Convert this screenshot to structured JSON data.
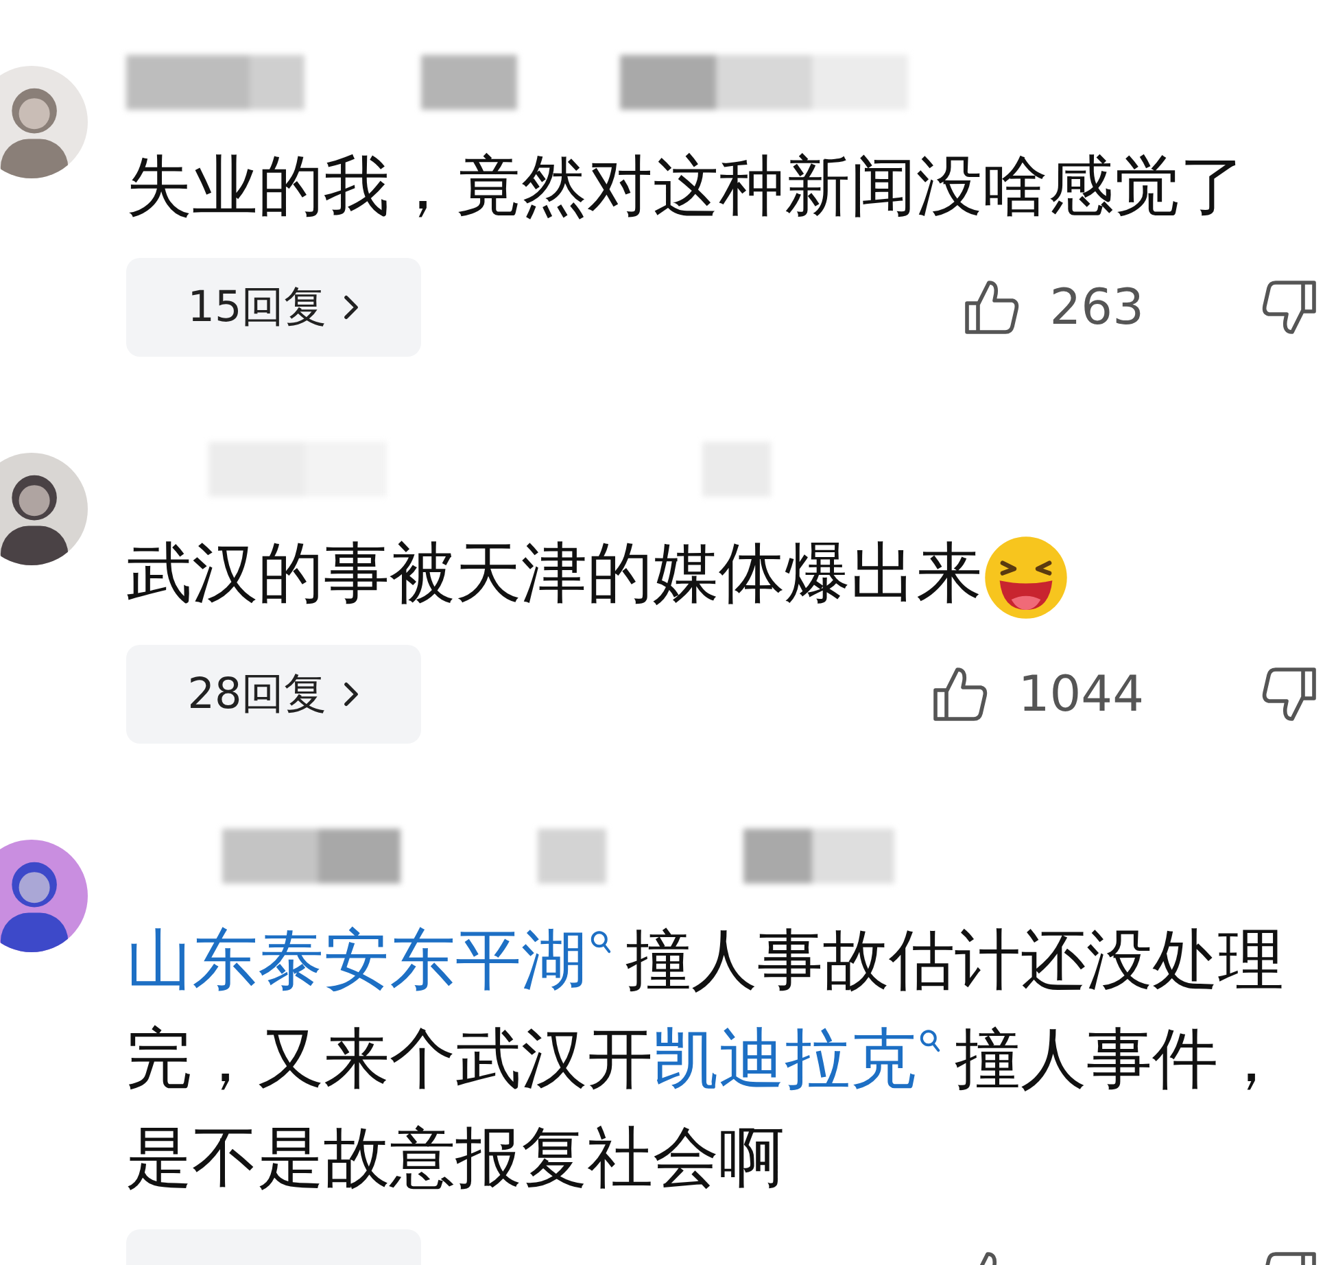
{
  "comments": [
    {
      "avatar": {
        "kind": "picture"
      },
      "text": [
        {
          "kind": "text",
          "text": "失业的我，竟然对这种新闻没啥感觉了"
        }
      ],
      "replies": "15回复",
      "likes": "263"
    },
    {
      "avatar": {
        "kind": "picture"
      },
      "text": [
        {
          "kind": "text",
          "text": "武汉的事被天津的媒体爆出来"
        },
        {
          "kind": "emoji"
        }
      ],
      "replies": "28回复",
      "likes": "1044"
    },
    {
      "avatar": {
        "kind": "picture"
      },
      "text": [
        {
          "kind": "link",
          "text": "山东泰安东平湖"
        },
        {
          "kind": "text",
          "text": "撞人事故估计还没处理完，又来个武汉开"
        },
        {
          "kind": "link",
          "text": "凯迪拉克"
        },
        {
          "kind": "text",
          "text": "撞人事件，是不是故意报复社会啊"
        }
      ]
    }
  ]
}
